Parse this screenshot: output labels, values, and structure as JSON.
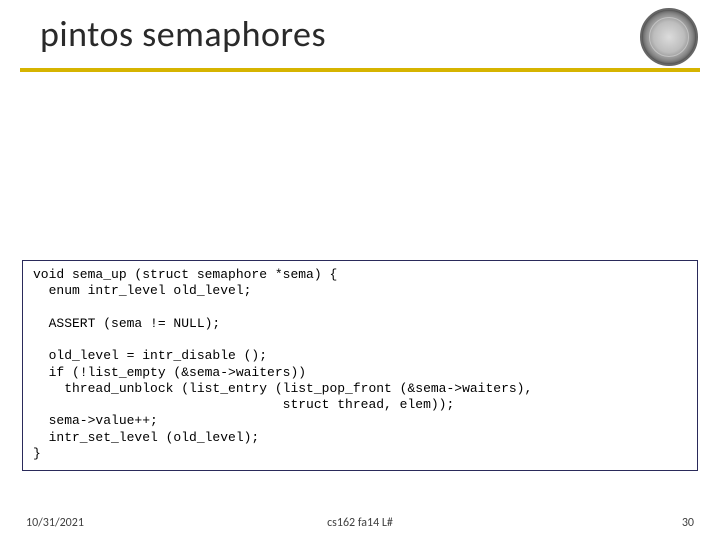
{
  "title": "pintos semaphores",
  "code": "void sema_up (struct semaphore *sema) {\n  enum intr_level old_level;\n\n  ASSERT (sema != NULL);\n\n  old_level = intr_disable ();\n  if (!list_empty (&sema->waiters))\n    thread_unblock (list_entry (list_pop_front (&sema->waiters),\n                                struct thread, elem));\n  sema->value++;\n  intr_set_level (old_level);\n}",
  "footer": {
    "date": "10/31/2021",
    "course": "cs162 fa14 L#",
    "page": "30"
  },
  "seal_alt": "university-seal"
}
